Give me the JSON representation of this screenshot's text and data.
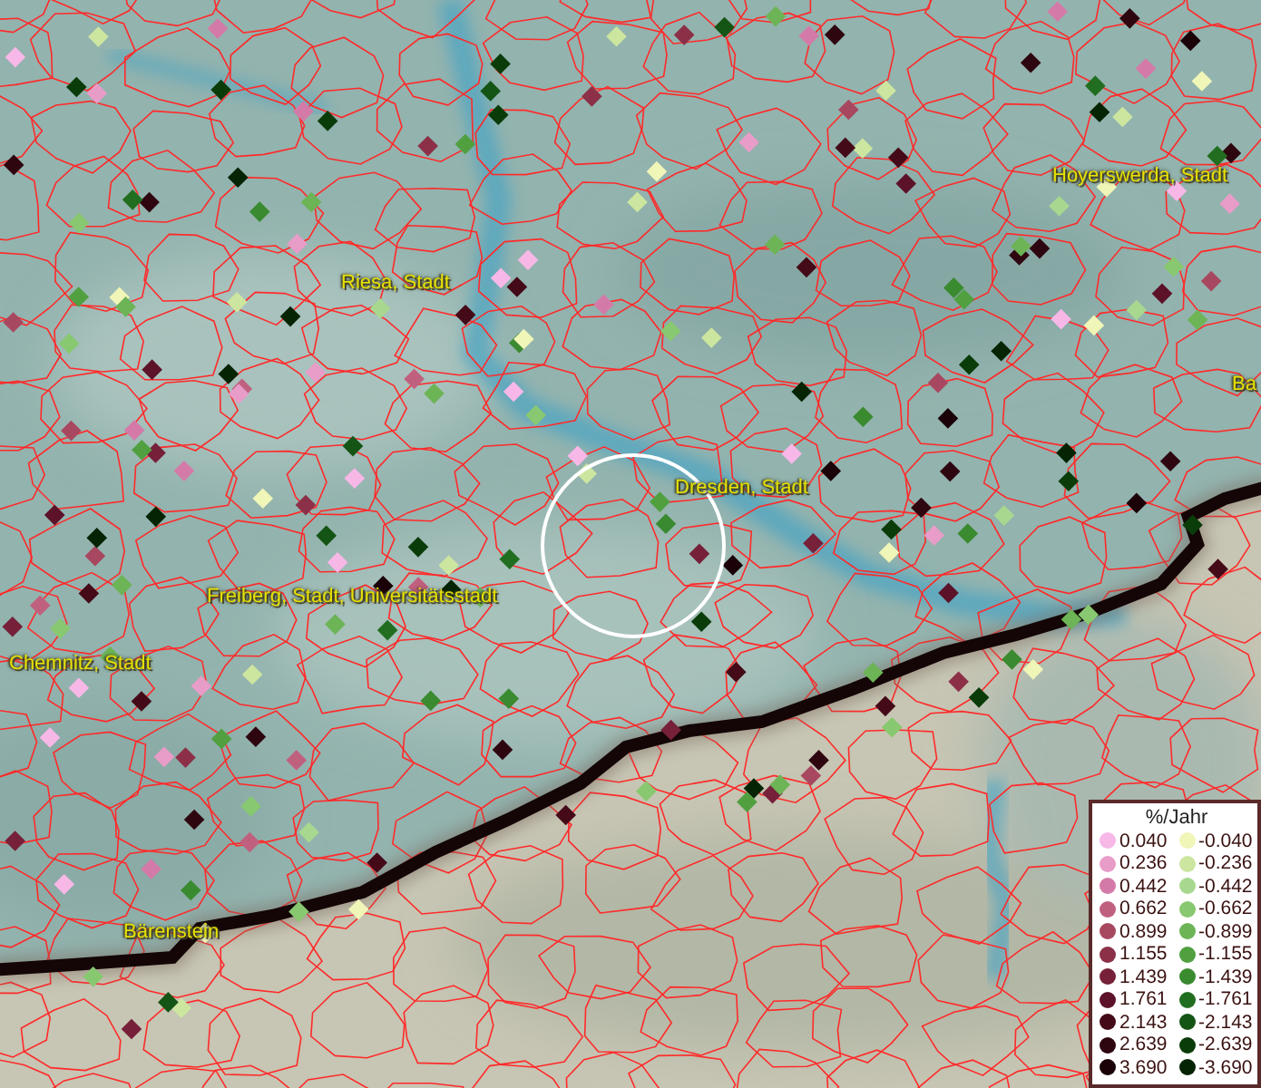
{
  "map": {
    "places": [
      {
        "text": "Riesa, Stadt"
      },
      {
        "text": "Hoyerswerda, Stadt"
      },
      {
        "text": "Dresden, Stadt"
      },
      {
        "text": "Freiberg, Stadt, Universitätsstadt"
      },
      {
        "text": "Chemnitz, Stadt"
      },
      {
        "text": "Bärenstein"
      },
      {
        "text": "Ba"
      }
    ]
  },
  "legend": {
    "title": "%/Jahr",
    "rows": [
      {
        "positive": {
          "value": "0.040",
          "color": "#f7b8e8"
        },
        "negative": {
          "value": "-0.040",
          "color": "#f0f5b8"
        }
      },
      {
        "positive": {
          "value": "0.236",
          "color": "#e89cc8"
        },
        "negative": {
          "value": "-0.236",
          "color": "#cce6a0"
        }
      },
      {
        "positive": {
          "value": "0.442",
          "color": "#d47aa8"
        },
        "negative": {
          "value": "-0.442",
          "color": "#a8d890"
        }
      },
      {
        "positive": {
          "value": "0.662",
          "color": "#c0607f"
        },
        "negative": {
          "value": "-0.662",
          "color": "#88c870"
        }
      },
      {
        "positive": {
          "value": "0.899",
          "color": "#a84860"
        },
        "negative": {
          "value": "-0.899",
          "color": "#6cb456"
        }
      },
      {
        "positive": {
          "value": "1.155",
          "color": "#8c3048"
        },
        "negative": {
          "value": "-1.155",
          "color": "#50a040"
        }
      },
      {
        "positive": {
          "value": "1.439",
          "color": "#76203a"
        },
        "negative": {
          "value": "-1.439",
          "color": "#3a8a30"
        }
      },
      {
        "positive": {
          "value": "1.761",
          "color": "#5c1228"
        },
        "negative": {
          "value": "-1.761",
          "color": "#226e20"
        }
      },
      {
        "positive": {
          "value": "2.143",
          "color": "#440a18"
        },
        "negative": {
          "value": "-2.143",
          "color": "#145414"
        }
      },
      {
        "positive": {
          "value": "2.639",
          "color": "#2e0610"
        },
        "negative": {
          "value": "-2.639",
          "color": "#0a3c0a"
        }
      },
      {
        "positive": {
          "value": "3.690",
          "color": "#1a0208"
        },
        "negative": {
          "value": "-3.690",
          "color": "#042404"
        }
      }
    ]
  }
}
